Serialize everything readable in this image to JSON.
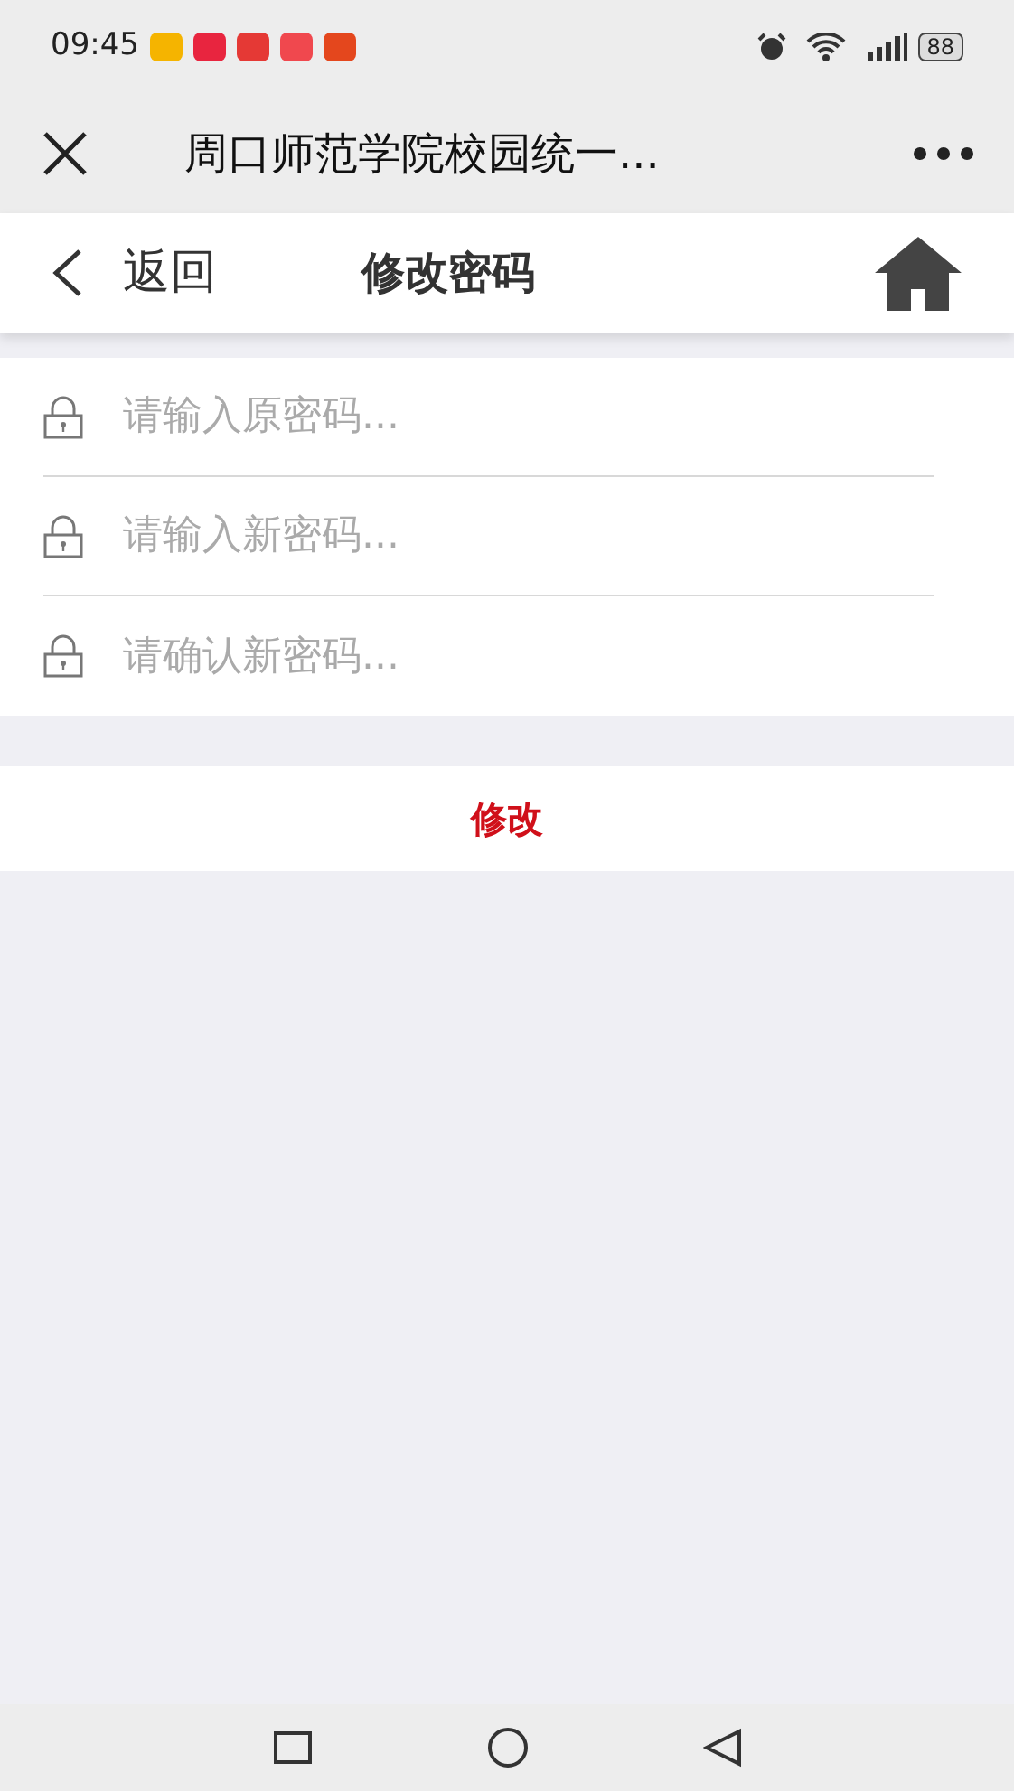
{
  "status_bar": {
    "time": "09:45",
    "notifications": [
      {
        "color": "#f5b400"
      },
      {
        "color": "#e8253f"
      },
      {
        "color": "#e53935"
      },
      {
        "color": "#f0484e"
      },
      {
        "color": "#e4471d"
      }
    ],
    "battery": "88"
  },
  "browser_bar": {
    "title": "周口师范学院校园统一..."
  },
  "nav": {
    "back": "返回",
    "title": "修改密码"
  },
  "fields": [
    {
      "placeholder": "请输入原密码..."
    },
    {
      "placeholder": "请输入新密码..."
    },
    {
      "placeholder": "请确认新密码..."
    }
  ],
  "submit": "修改"
}
